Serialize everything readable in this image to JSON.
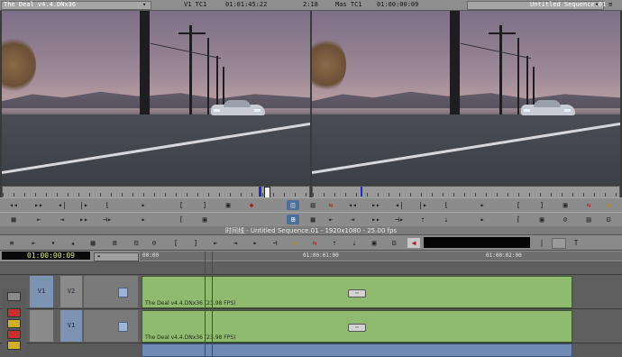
{
  "source_monitor": {
    "clip_name": "The Deal v4.4.DNx36",
    "tc_label": "V1 TC1",
    "tc_value": "01:01:45:22",
    "duration": "2:18"
  },
  "record_monitor": {
    "tc_label": "Mas TC1",
    "tc_value": "01:00:00:09",
    "sequence_name": "Untitled Sequence.01"
  },
  "timeline": {
    "title": "时间线 - Untitled Sequence.01 - 1920x1080 - 25.00 fps",
    "timecode": "01:00:00:09",
    "ruler": [
      "00:00",
      "01:00:01:00",
      "01:00:02:00"
    ],
    "tracks": [
      {
        "src": "V1",
        "rec": "V2",
        "clip": "The Deal v4.4.DNx36 (23.98 FPS)",
        "fx": "▭"
      },
      {
        "src": "",
        "rec": "V1",
        "clip": "The Deal v4.4.DNx36 (23.98 FPS)",
        "fx": "▭"
      }
    ]
  },
  "colors": {
    "clip_green": "#8fba70",
    "track_blue": "#7d93b4",
    "playhead": "#2a3fd0",
    "timecode_text": "#d8e87a"
  },
  "icons": {
    "transport": [
      "rewind-icon",
      "fast-forward-icon",
      "step-back-icon",
      "step-forward-icon",
      "mark-in-icon",
      "play-icon",
      "mark-out-icon",
      "clear-icon",
      "record-icon"
    ],
    "tools": [
      "segment-red-icon",
      "segment-yellow-icon",
      "lift-icon",
      "extract-icon"
    ]
  }
}
